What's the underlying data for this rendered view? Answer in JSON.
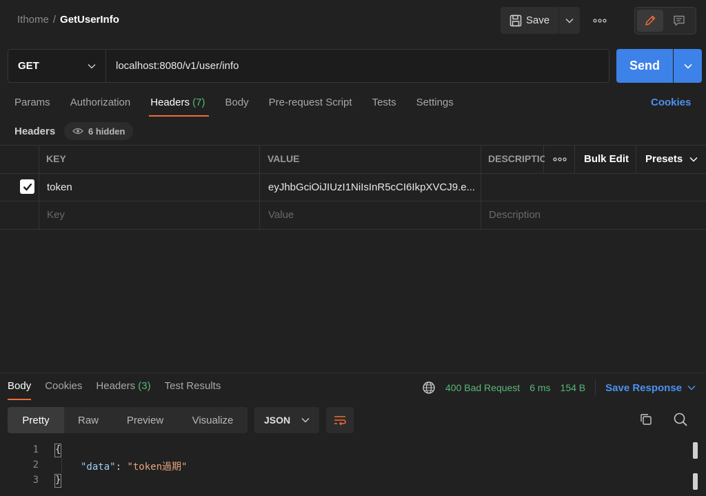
{
  "breadcrumb": {
    "workspace": "Ithome",
    "separator": "/",
    "request_name": "GetUserInfo"
  },
  "toolbar": {
    "save_label": "Save",
    "more_icon": "ellipsis-icon",
    "edit_icon": "pencil-icon",
    "comment_icon": "comment-icon"
  },
  "request": {
    "method": "GET",
    "url": "localhost:8080/v1/user/info",
    "send_label": "Send"
  },
  "request_tabs": [
    {
      "label": "Params"
    },
    {
      "label": "Authorization"
    },
    {
      "label": "Headers",
      "count": "(7)",
      "active": true
    },
    {
      "label": "Body"
    },
    {
      "label": "Pre-request Script"
    },
    {
      "label": "Tests"
    },
    {
      "label": "Settings"
    }
  ],
  "cookies_label": "Cookies",
  "headers_section": {
    "label": "Headers",
    "hidden_label": "6 hidden"
  },
  "headers_table": {
    "columns": {
      "key": "KEY",
      "value": "VALUE",
      "description": "DESCRIPTION"
    },
    "bulk_edit_label": "Bulk Edit",
    "presets_label": "Presets",
    "rows": [
      {
        "checked": true,
        "key": "token",
        "value": "eyJhbGciOiJIUzI1NiIsInR5cCI6IkpXVCJ9.e...",
        "description": ""
      }
    ],
    "placeholders": {
      "key": "Key",
      "value": "Value",
      "description": "Description"
    }
  },
  "response_tabs": [
    {
      "label": "Body",
      "active": true
    },
    {
      "label": "Cookies"
    },
    {
      "label": "Headers",
      "count": "(3)"
    },
    {
      "label": "Test Results"
    }
  ],
  "response_status": {
    "status": "400 Bad Request",
    "time": "6 ms",
    "size": "154 B",
    "save_label": "Save Response"
  },
  "view_modes": [
    {
      "label": "Pretty",
      "active": true
    },
    {
      "label": "Raw"
    },
    {
      "label": "Preview"
    },
    {
      "label": "Visualize"
    }
  ],
  "format": "JSON",
  "code": {
    "line_numbers": [
      "1",
      "2",
      "3"
    ],
    "open_brace": "{",
    "close_brace": "}",
    "key": "\"data\"",
    "colon": ": ",
    "value": "\"token過期\""
  },
  "colors": {
    "accent": "#f26b3a",
    "primary": "#3d82e8",
    "link": "#4a92f0",
    "success": "#58b87a"
  }
}
